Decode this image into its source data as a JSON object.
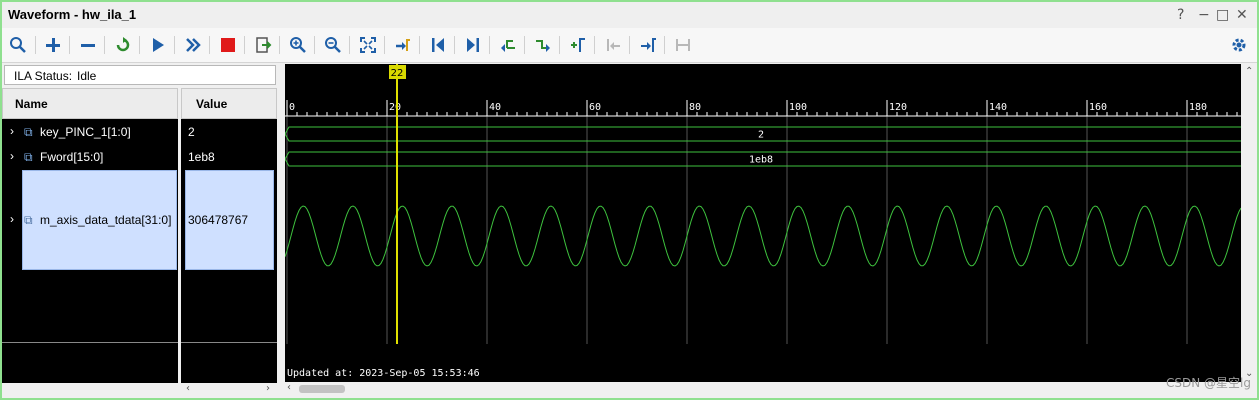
{
  "window": {
    "title": "Waveform - hw_ila_1",
    "help_glyph": "?",
    "minimize_glyph": "−",
    "maximize_glyph": "□",
    "close_glyph": "✕"
  },
  "toolbar": {
    "buttons": [
      "search-icon",
      "add-icon",
      "remove-icon",
      "refresh-icon",
      "run-trigger-icon",
      "run-immediate-icon",
      "stop-icon",
      "export-icon",
      "zoom-in-icon",
      "zoom-out-icon",
      "zoom-fit-icon",
      "go-to-cursor-icon",
      "go-to-start-icon",
      "go-to-end-icon",
      "previous-transition-icon",
      "next-transition-icon",
      "add-marker-icon",
      "previous-marker-icon",
      "next-marker-icon",
      "swap-cursors-icon"
    ],
    "settings_icon": "gear-icon"
  },
  "ila_status": {
    "label": "ILA Status:",
    "value": "Idle"
  },
  "columns": {
    "name": "Name",
    "value": "Value"
  },
  "signals": [
    {
      "name": "key_PINC_1[1:0]",
      "value": "2",
      "bus_label": "2"
    },
    {
      "name": "Fword[15:0]",
      "value": "1eb8",
      "bus_label": "1eb8"
    },
    {
      "name": "m_axis_data_tdata[31:0]",
      "value": "306478767",
      "analog": true
    }
  ],
  "timeline": {
    "ticks": [
      "0",
      "20",
      "40",
      "60",
      "80",
      "100",
      "120",
      "140",
      "160",
      "180"
    ],
    "cursor": "22"
  },
  "updated_at": "Updated at: 2023-Sep-05 15:53:46",
  "watermark": "CSDN @星空lg",
  "colors": {
    "wave": "#3ec23e",
    "cursor": "#e0e000",
    "background": "#000000",
    "selection": "#cfe0ff"
  }
}
